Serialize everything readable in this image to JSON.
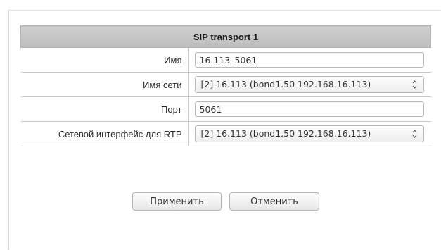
{
  "section": {
    "title": "SIP transport 1"
  },
  "fields": {
    "name": {
      "label": "Имя",
      "value": "16.113_5061"
    },
    "network_name": {
      "label": "Имя сети",
      "selected": "[2] 16.113 (bond1.50 192.168.16.113)"
    },
    "port": {
      "label": "Порт",
      "value": "5061"
    },
    "rtp_interface": {
      "label": "Сетевой интерфейс для RTP",
      "selected": "[2] 16.113 (bond1.50 192.168.16.113)"
    }
  },
  "actions": {
    "apply_label": "Применить",
    "cancel_label": "Отменить"
  },
  "icons": {
    "select_arrows": "up-down-chevron-icon"
  },
  "colors": {
    "header_bg": "#c4c4c4",
    "border": "#c9c9c9"
  }
}
